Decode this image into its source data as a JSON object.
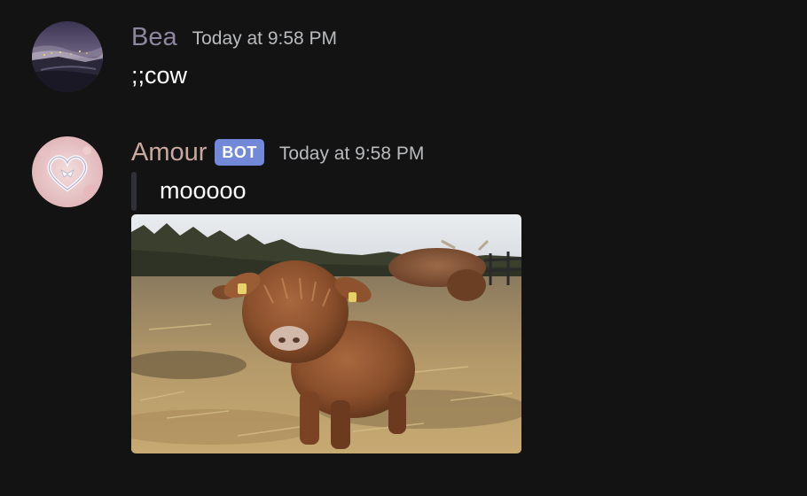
{
  "messages": [
    {
      "author": "Bea",
      "timestamp": "Today at 9:58 PM",
      "text": ";;cow",
      "avatar_icon": "night-landscape-avatar"
    },
    {
      "author": "Amour",
      "badge": "BOT",
      "timestamp": "Today at 9:58 PM",
      "embed_text": "mooooo",
      "avatar_icon": "heart-avatar",
      "attachment": "highland-calf-gif"
    }
  ],
  "colors": {
    "background": "#131313",
    "bea_name": "#8e879f",
    "amour_name": "#c9a8a0",
    "bot_badge": "#7289da",
    "timestamp": "#b9bbbe",
    "embed_bar": "#2f3136"
  }
}
